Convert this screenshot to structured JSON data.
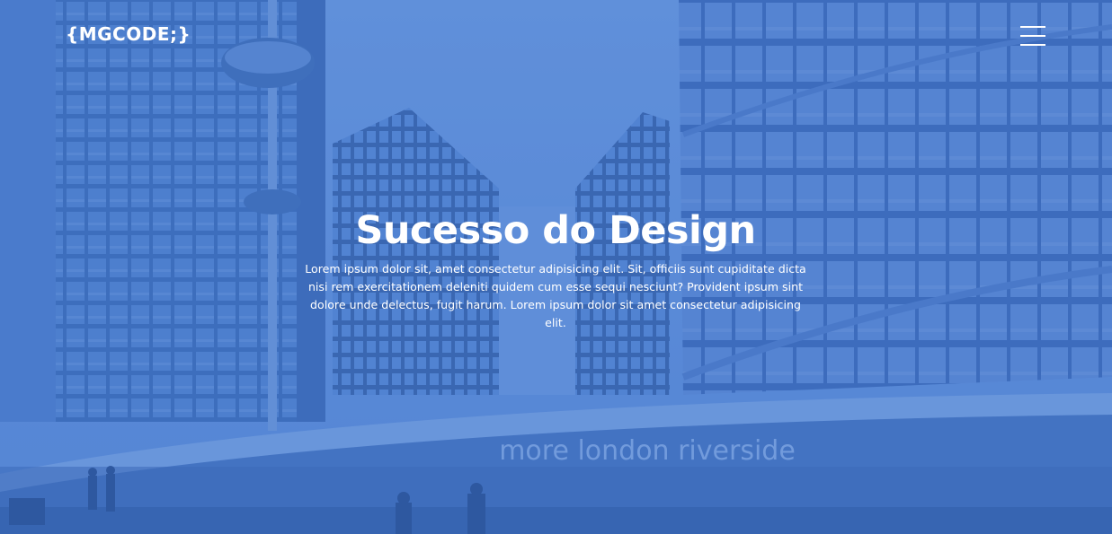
{
  "header": {
    "logo_text": "{MGCODE;}",
    "menu_icon": "hamburger-menu-icon"
  },
  "hero": {
    "title": "Sucesso do Design",
    "text": "Lorem ipsum dolor sit, amet consectetur adipisicing elit. Sit, officiis sunt cupiditate dicta nisi rem exercitationem deleniti quidem cum esse sequi nesciunt? Provident ipsum sint dolore unde delectus, fugit harum. Lorem ipsum dolor sit amet consectetur adipisicing elit.",
    "background_sign": "more london riverside"
  },
  "colors": {
    "overlay": "#4a80d8",
    "text": "#ffffff"
  }
}
